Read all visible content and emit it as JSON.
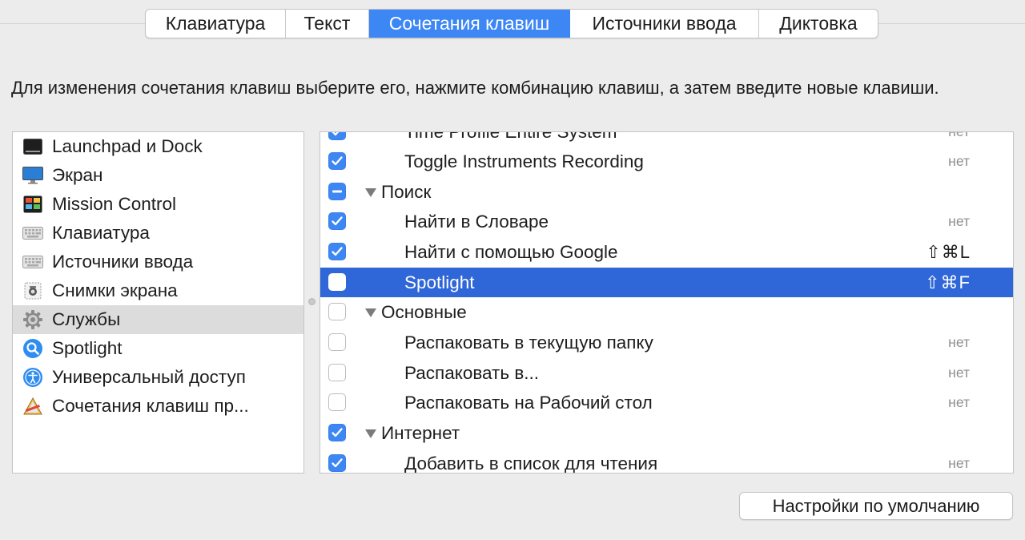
{
  "tabs": [
    "Клавиатура",
    "Текст",
    "Сочетания клавиш",
    "Источники ввода",
    "Диктовка"
  ],
  "active_tab": 2,
  "description": "Для изменения сочетания клавиш выберите его, нажмите комбинацию клавиш, а затем введите новые клавиши.",
  "categories": [
    {
      "label": "Launchpad и Dock",
      "icon": "launchpad-dock-icon"
    },
    {
      "label": "Экран",
      "icon": "display-icon"
    },
    {
      "label": "Mission Control",
      "icon": "mission-control-icon"
    },
    {
      "label": "Клавиатура",
      "icon": "keyboard-icon"
    },
    {
      "label": "Источники ввода",
      "icon": "input-sources-icon"
    },
    {
      "label": "Снимки экрана",
      "icon": "screenshot-icon"
    },
    {
      "label": "Службы",
      "icon": "gear-icon",
      "selected": true
    },
    {
      "label": "Spotlight",
      "icon": "spotlight-search-icon"
    },
    {
      "label": "Универсальный доступ",
      "icon": "accessibility-icon"
    },
    {
      "label": "Сочетания клавиш пр...",
      "icon": "app-shortcuts-icon"
    }
  ],
  "shortcuts": [
    {
      "label": "Time Profile Entire System",
      "state": "checked",
      "kind": "item",
      "shortcut": "нет",
      "clipped": true
    },
    {
      "label": "Toggle Instruments Recording",
      "state": "checked",
      "kind": "item",
      "shortcut": "нет"
    },
    {
      "label": "Поиск",
      "state": "mixed",
      "kind": "group",
      "shortcut": ""
    },
    {
      "label": "Найти в Словаре",
      "state": "checked",
      "kind": "item",
      "shortcut": "нет"
    },
    {
      "label": "Найти с помощью Google",
      "state": "checked",
      "kind": "item",
      "shortcut": "⇧⌘L"
    },
    {
      "label": "Spotlight",
      "state": "empty",
      "kind": "item",
      "shortcut": "⇧⌘F",
      "selected": true
    },
    {
      "label": "Основные",
      "state": "empty",
      "kind": "group",
      "shortcut": ""
    },
    {
      "label": "Распаковать в текущую папку",
      "state": "empty",
      "kind": "item",
      "shortcut": "нет"
    },
    {
      "label": "Распаковать в...",
      "state": "empty",
      "kind": "item",
      "shortcut": "нет"
    },
    {
      "label": "Распаковать на Рабочий стол",
      "state": "empty",
      "kind": "item",
      "shortcut": "нет"
    },
    {
      "label": "Интернет",
      "state": "checked",
      "kind": "group",
      "shortcut": ""
    },
    {
      "label": "Добавить в список для чтения",
      "state": "checked",
      "kind": "item",
      "shortcut": "нет"
    }
  ],
  "defaults_button": "Настройки по умолчанию",
  "colors": {
    "accent": "#3d87f5",
    "selection": "#2f66d8",
    "background": "#ececec"
  }
}
